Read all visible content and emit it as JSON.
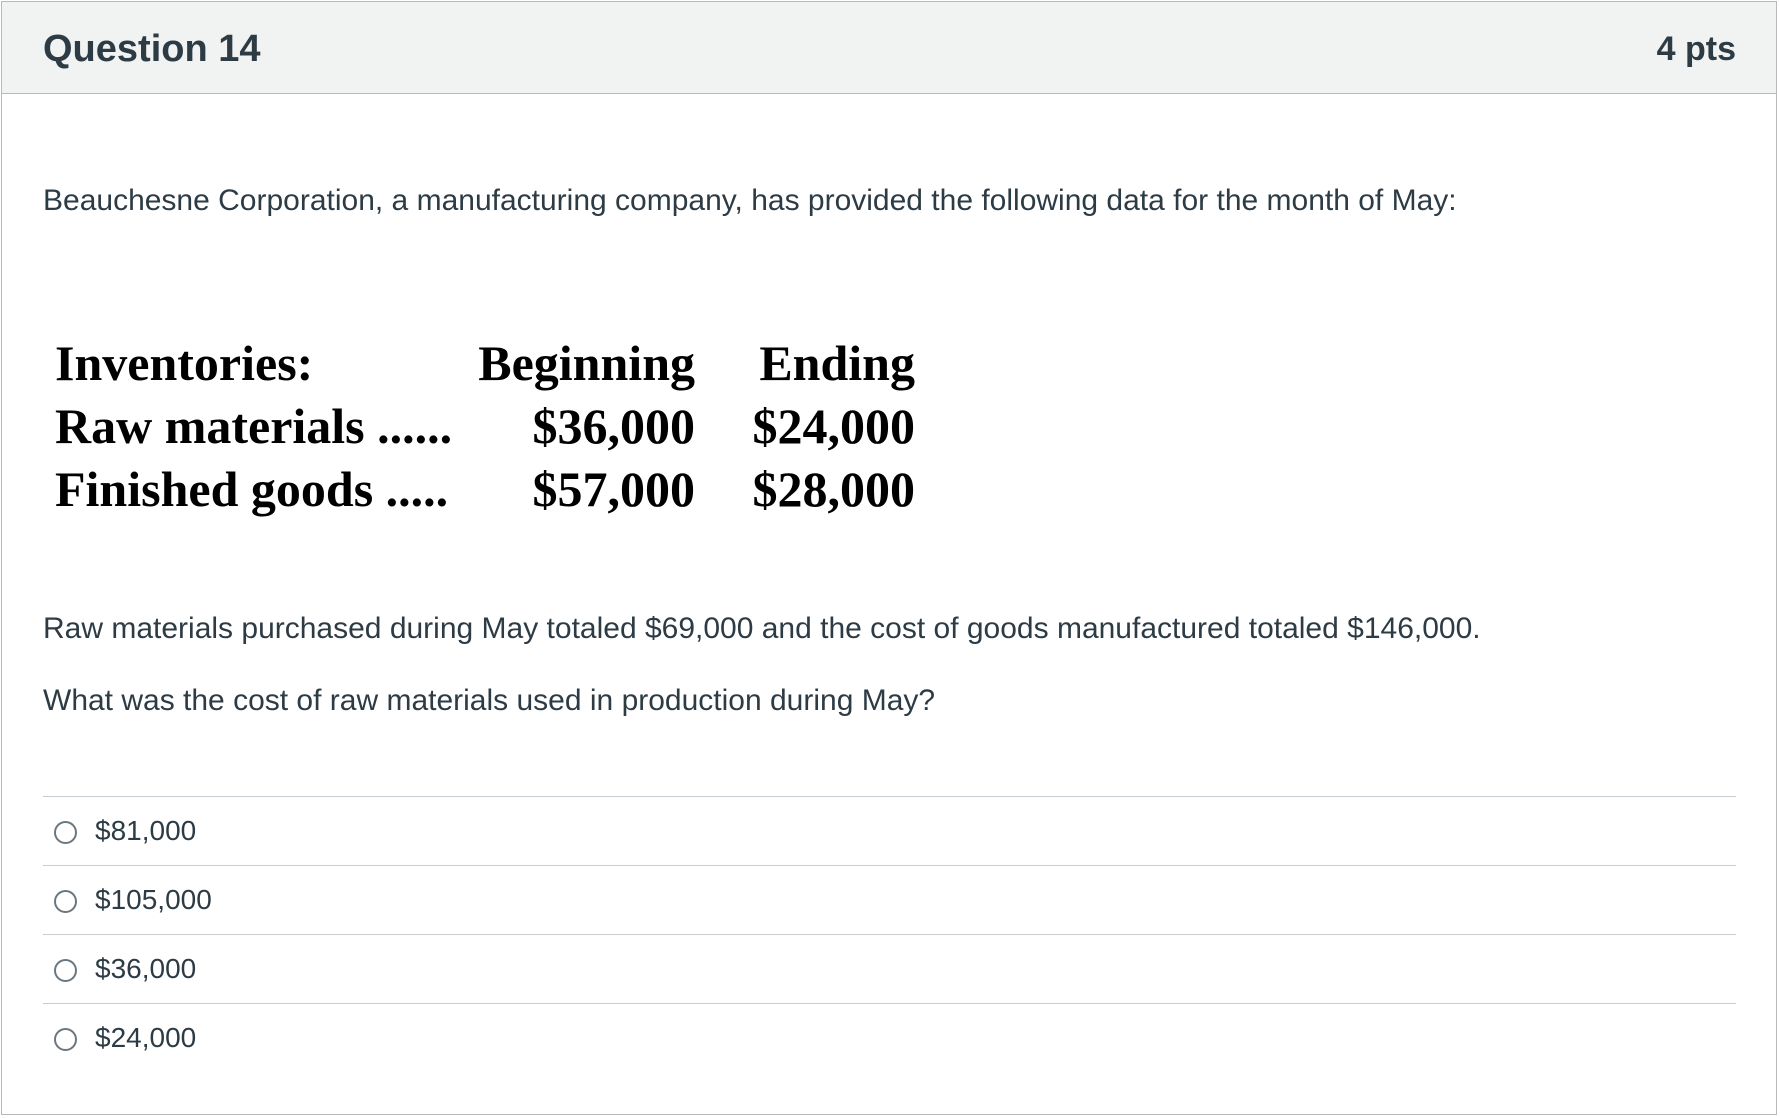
{
  "question": {
    "title": "Question 14",
    "points": "4 pts"
  },
  "intro": "Beauchesne Corporation, a manufacturing company, has provided the following data for the month of May:",
  "inventory_table": {
    "header": [
      "Inventories:",
      "Beginning",
      "Ending"
    ],
    "rows": [
      [
        "Raw materials ......",
        "$36,000",
        "$24,000"
      ],
      [
        "Finished goods .....",
        "$57,000",
        "$28,000"
      ]
    ]
  },
  "paragraph": "Raw materials purchased during May totaled $69,000 and the cost of goods manufactured totaled $146,000.",
  "prompt": "What was the cost of raw materials used in production during May?",
  "answers": [
    {
      "label": "$81,000",
      "selected": false
    },
    {
      "label": "$105,000",
      "selected": false
    },
    {
      "label": "$36,000",
      "selected": false
    },
    {
      "label": "$24,000",
      "selected": false
    }
  ]
}
